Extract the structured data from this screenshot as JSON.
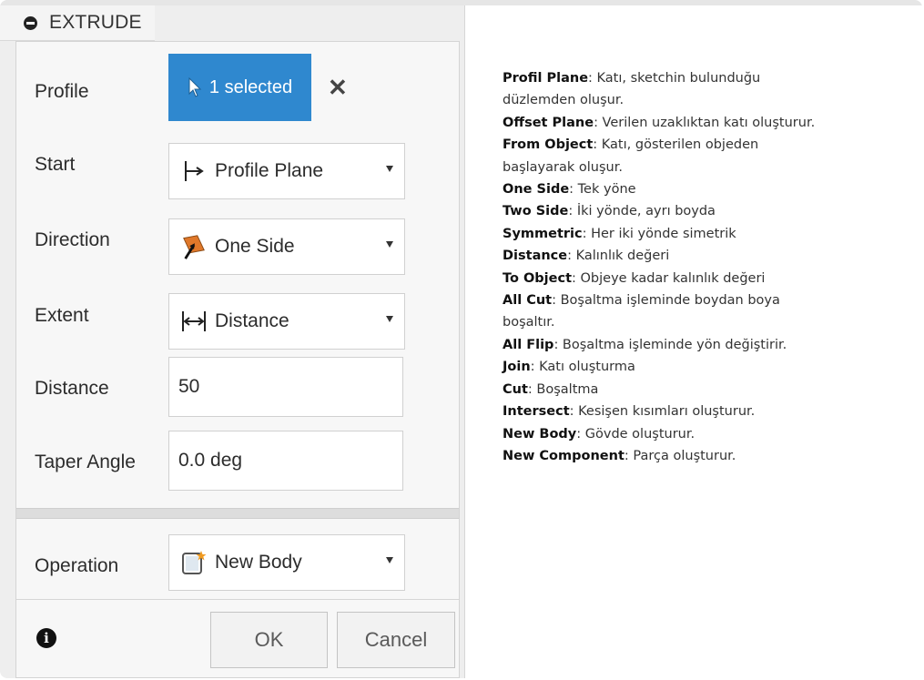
{
  "dialog": {
    "title": "EXTRUDE",
    "profile_label": "Profile",
    "profile_value": "1 selected",
    "start_label": "Start",
    "start_value": "Profile Plane",
    "direction_label": "Direction",
    "direction_value": "One Side",
    "extent_label": "Extent",
    "extent_value": "Distance",
    "distance_label": "Distance",
    "distance_value": "50",
    "taper_label": "Taper Angle",
    "taper_value": "0.0 deg",
    "operation_label": "Operation",
    "operation_value": "New Body",
    "ok_label": "OK",
    "cancel_label": "Cancel",
    "accent_color": "#2f88cf",
    "icons": [
      "collapse-icon",
      "cursor-icon",
      "close-icon",
      "profile-plane-icon",
      "one-side-icon",
      "distance-icon",
      "new-body-icon",
      "info-icon",
      "chevron-down-icon"
    ]
  },
  "descriptions": [
    {
      "term": "Profil Plane",
      "text": ": Katı, sketchin bulunduğu"
    },
    {
      "term": "",
      "text": "düzlemden oluşur."
    },
    {
      "term": "Offset Plane",
      "text": ": Verilen uzaklıktan katı oluşturur."
    },
    {
      "term": "From Object",
      "text": ": Katı, gösterilen objeden"
    },
    {
      "term": "",
      "text": "başlayarak oluşur."
    },
    {
      "term": "One Side",
      "text": ": Tek yöne"
    },
    {
      "term": "Two Side",
      "text": ": İki yönde, ayrı boyda"
    },
    {
      "term": "Symmetric",
      "text": ": Her iki yönde simetrik"
    },
    {
      "term": "Distance",
      "text": ": Kalınlık değeri"
    },
    {
      "term": "To Object",
      "text": ": Objeye kadar kalınlık değeri"
    },
    {
      "term": "All Cut",
      "text": ": Boşaltma işleminde boydan boya"
    },
    {
      "term": "",
      "text": "boşaltır."
    },
    {
      "term": "All Flip",
      "text": ": Boşaltma işleminde yön değiştirir."
    },
    {
      "term": "Join",
      "text": ": Katı oluşturma"
    },
    {
      "term": "Cut",
      "text": ": Boşaltma"
    },
    {
      "term": "Intersect",
      "text": ": Kesişen kısımları oluşturur."
    },
    {
      "term": "New Body",
      "text": ": Gövde oluşturur."
    },
    {
      "term": "New Component",
      "text": ": Parça oluşturur."
    }
  ]
}
